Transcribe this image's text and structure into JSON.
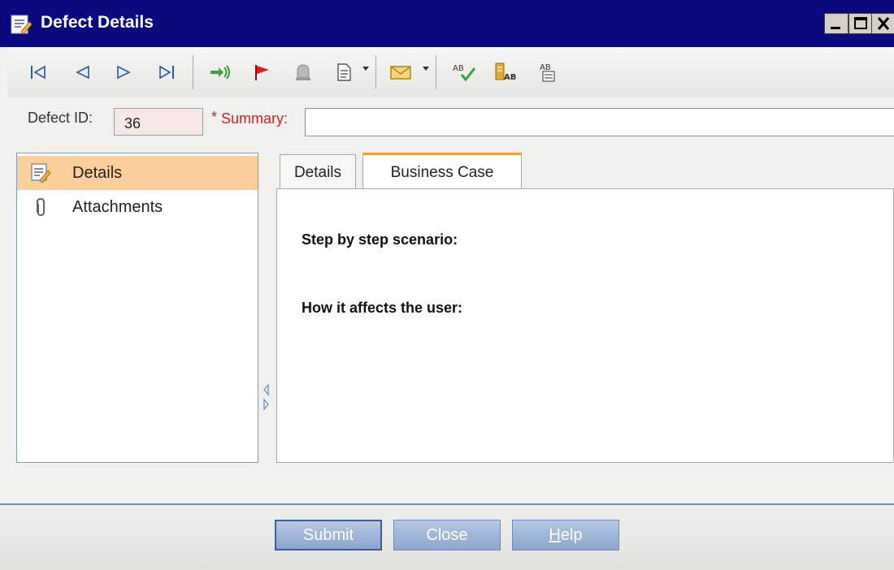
{
  "window": {
    "title": "Defect Details",
    "controls": {
      "minimize": "minimize",
      "maximize": "maximize",
      "close": "close"
    }
  },
  "toolbar": {
    "buttons": [
      {
        "icon": "first-record-icon"
      },
      {
        "icon": "previous-record-icon"
      },
      {
        "icon": "next-record-icon"
      },
      {
        "icon": "last-record-icon"
      },
      {
        "icon": "send-icon"
      },
      {
        "icon": "flag-icon"
      },
      {
        "icon": "alert-bell-icon"
      },
      {
        "icon": "document-icon",
        "has_dropdown": true
      },
      {
        "icon": "mail-icon",
        "has_dropdown": true
      },
      {
        "icon": "spell-check-icon"
      },
      {
        "icon": "thesaurus-icon"
      },
      {
        "icon": "spelling-options-icon"
      }
    ]
  },
  "fields": {
    "defect_id_label": "Defect ID:",
    "defect_id_value": "36",
    "summary_required_mark": "*",
    "summary_label": "Summary:",
    "summary_value": ""
  },
  "sidebar": {
    "items": [
      {
        "label": "Details",
        "icon": "details-icon",
        "selected": true
      },
      {
        "label": "Attachments",
        "icon": "paperclip-icon",
        "selected": false
      }
    ]
  },
  "tabs": [
    {
      "label": "Details",
      "active": false
    },
    {
      "label": "Business Case",
      "active": true
    }
  ],
  "content": {
    "heading1": "Step by step scenario:",
    "heading2": "How it affects the user:"
  },
  "buttons": {
    "submit": "Submit",
    "close": "Close",
    "help_mnemonic": "H",
    "help_rest": "elp"
  },
  "colors": {
    "titlebar": "#0a0a7e",
    "selected_nav": "#fbcf9b",
    "active_tab_accent": "#f0a030",
    "required": "#cc2222",
    "button": "#8aa6cf"
  }
}
